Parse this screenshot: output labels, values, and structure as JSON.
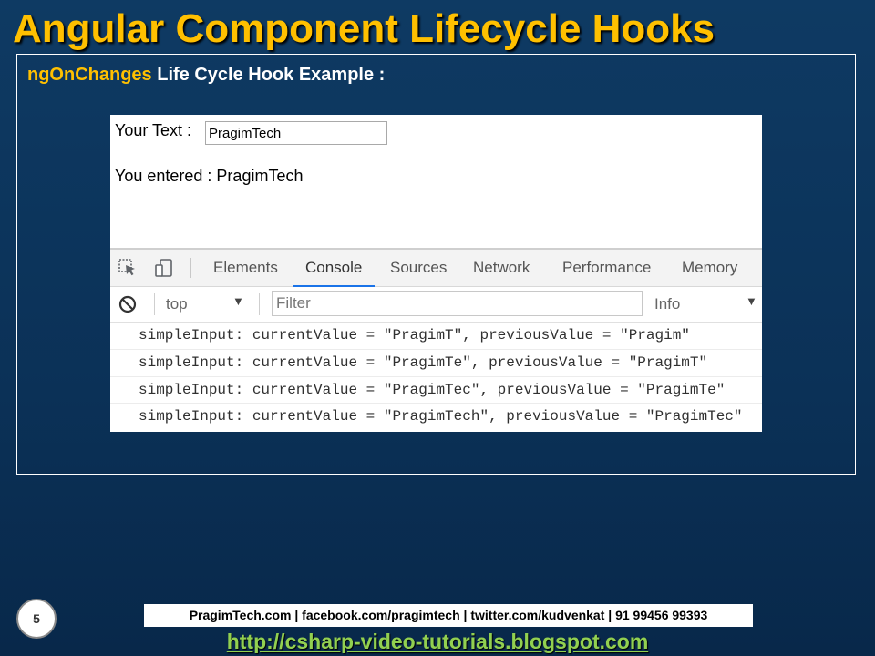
{
  "slide": {
    "title": "Angular Component Lifecycle Hooks",
    "subtitle_keyword": "ngOnChanges",
    "subtitle_rest": " Life Cycle Hook Example :",
    "page_number": "5"
  },
  "app": {
    "label": "Your Text :",
    "input_value": "PragimTech",
    "entered_text": "You entered : PragimTech"
  },
  "devtools": {
    "icons": [
      "inspect-element-icon",
      "device-toolbar-icon"
    ],
    "tabs": [
      "Elements",
      "Console",
      "Sources",
      "Network",
      "Performance",
      "Memory"
    ],
    "active_tab": "Console",
    "context": "top",
    "filter_placeholder": "Filter",
    "level": "Info",
    "logs": [
      "simpleInput: currentValue = \"PragimT\", previousValue = \"Pragim\"",
      "simpleInput: currentValue = \"PragimTe\", previousValue = \"PragimT\"",
      "simpleInput: currentValue = \"PragimTec\", previousValue = \"PragimTe\"",
      "simpleInput: currentValue = \"PragimTech\", previousValue = \"PragimTec\""
    ]
  },
  "footer": {
    "contact": "PragimTech.com | facebook.com/pragimtech | twitter.com/kudvenkat | 91 99456 99393",
    "link": "http://csharp-video-tutorials.blogspot.com"
  },
  "colors": {
    "title": "#ffc000",
    "background": "#0b3157",
    "link": "#92d050",
    "active_tab_underline": "#1a73e8"
  }
}
